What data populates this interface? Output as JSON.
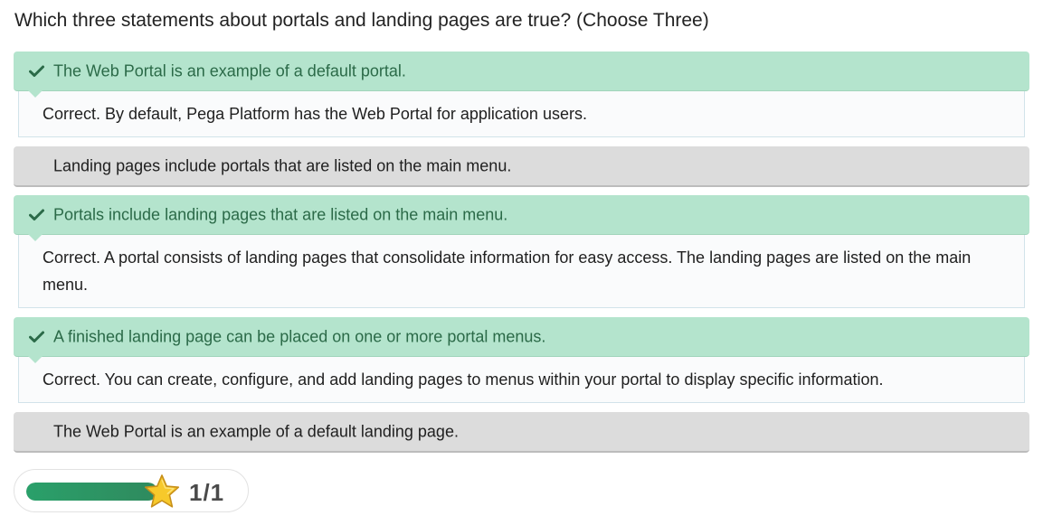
{
  "question": "Which three statements about portals and landing pages are true? (Choose Three)",
  "options": [
    {
      "label": "The Web Portal is an example of a default portal.",
      "state": "correct",
      "feedback": "Correct. By default, Pega Platform has the Web Portal for application users."
    },
    {
      "label": "Landing pages include portals that are listed on the main menu.",
      "state": "neutral"
    },
    {
      "label": "Portals include landing pages that are listed on the main menu.",
      "state": "correct",
      "feedback": "Correct. A portal consists of landing pages that consolidate information for easy access. The landing pages are listed on the main menu."
    },
    {
      "label": "A finished landing page can be placed on one or more portal menus.",
      "state": "correct",
      "feedback": "Correct. You can create, configure, and add landing pages to menus within your portal to display specific information."
    },
    {
      "label": "The Web Portal is an example of a default landing page.",
      "state": "neutral"
    }
  ],
  "score": {
    "text": "1/1",
    "progress_percent": 100,
    "icon": "star-icon"
  },
  "colors": {
    "correct_bg": "#b4e4cd",
    "correct_text": "#2b6a48",
    "neutral_bg": "#dcdcdc",
    "progress": "#2aa06a",
    "star": "#f7c92b"
  }
}
